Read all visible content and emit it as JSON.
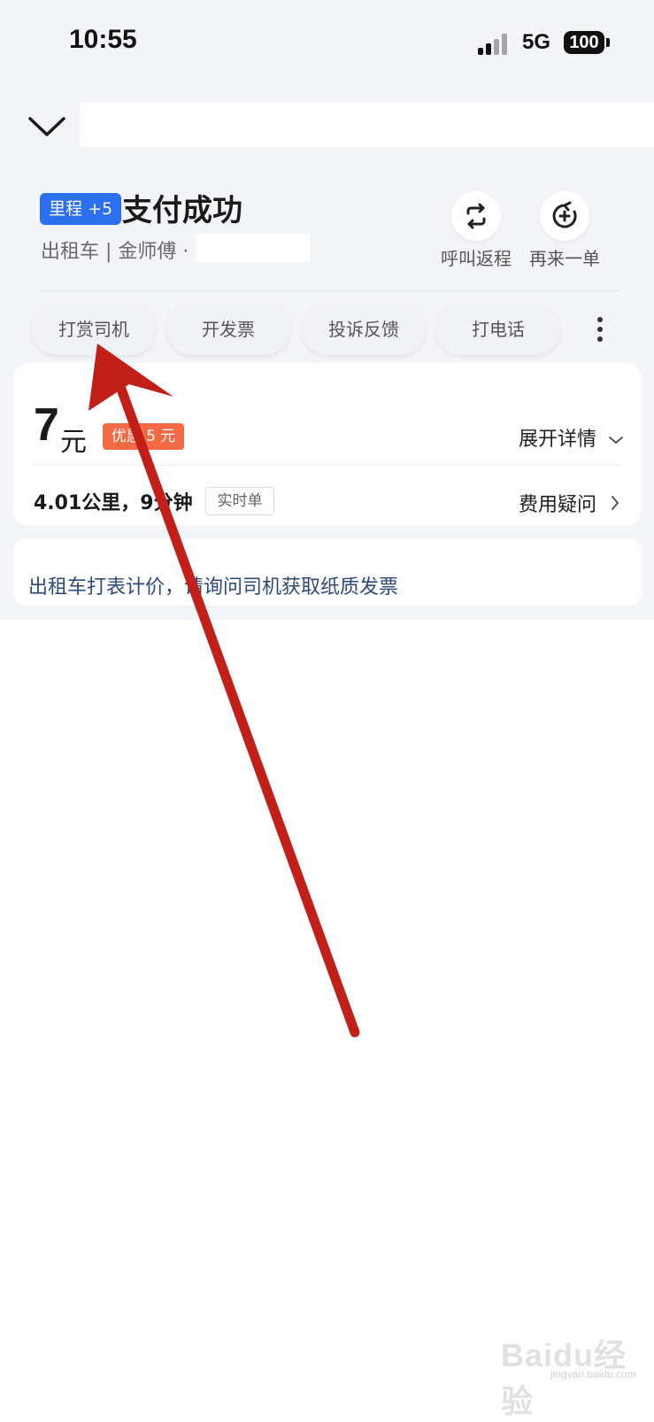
{
  "status_bar": {
    "time": "10:55",
    "network": "5G",
    "battery": "100"
  },
  "header": {
    "back_icon": "chevron-down-icon"
  },
  "order": {
    "mileage_badge": "里程 +5",
    "title": "支付成功",
    "subtitle": "出租车 | 金师傅 ·",
    "actions": [
      {
        "label": "呼叫返程",
        "icon": "return-trip-icon"
      },
      {
        "label": "再来一单",
        "icon": "reorder-icon"
      }
    ]
  },
  "quick_actions": [
    "打赏司机",
    "开发票",
    "投诉反馈",
    "打电话"
  ],
  "fare": {
    "amount": "7",
    "unit": "元",
    "discount": "优惠 5 元",
    "detail_label": "展开详情",
    "trip_info": "4.01公里，9分钟",
    "trip_tag": "实时单",
    "fee_question": "费用疑问"
  },
  "notice": "出租车打表计价，请询问司机获取纸质发票",
  "watermark": {
    "text": "Baidu经验",
    "sub": "jingyan.baidu.com"
  },
  "colors": {
    "accent": "#2b6ff3",
    "discount": "#f36a45",
    "arrow": "#c11f17",
    "notice": "#2d4a7a"
  }
}
